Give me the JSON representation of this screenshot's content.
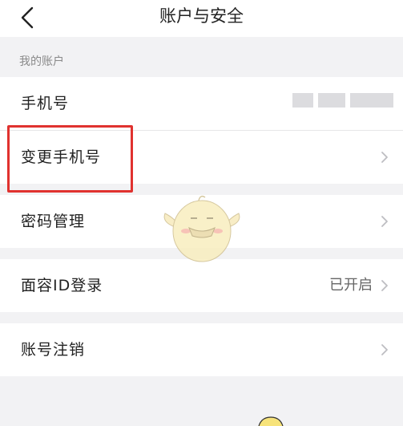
{
  "nav": {
    "title": "账户与安全",
    "back_icon": "chevron-left-icon"
  },
  "section": {
    "header": "我的账户"
  },
  "rows": {
    "phone": {
      "label": "手机号",
      "value_masked": true
    },
    "change_phone": {
      "label": "变更手机号"
    },
    "password": {
      "label": "密码管理"
    },
    "face_id": {
      "label": "面容ID登录",
      "value": "已开启"
    },
    "cancel_account": {
      "label": "账号注销"
    }
  },
  "colors": {
    "background": "#f2f2f4",
    "row_background": "#ffffff",
    "highlight_border": "#e0322f",
    "secondary_text": "#8a8a8a",
    "chevron": "#bdbdc2"
  }
}
